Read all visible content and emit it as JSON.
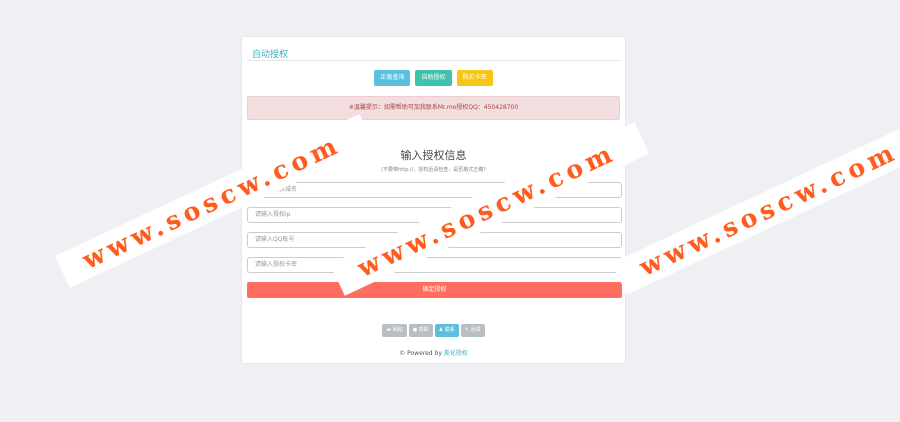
{
  "panel": {
    "title": "自动授权",
    "buttons": [
      {
        "label": "正版查询",
        "color": "#5bc0de"
      },
      {
        "label": "自助授权",
        "color": "#3fc3ad"
      },
      {
        "label": "购买卡密",
        "color": "#f5c518"
      }
    ],
    "alert": "※温馨提示：如需帮助可加我联系Mr.mo授权QQ：450428700"
  },
  "form": {
    "heading": "输入授权信息",
    "subheading": "(不要带http://，授权后请检查，是否格式正确?",
    "fields": [
      {
        "placeholder": "请输入授权域名"
      },
      {
        "placeholder": "请输入授权ip"
      },
      {
        "placeholder": "请输入QQ账号"
      },
      {
        "placeholder": "请输入授权卡密"
      }
    ],
    "submit_label": "确定授权"
  },
  "footer": {
    "nav": [
      {
        "label": "网站",
        "icon": "window-icon",
        "active": false
      },
      {
        "label": "帮助",
        "icon": "help-circle-icon",
        "active": false
      },
      {
        "label": "联系",
        "icon": "user-icon",
        "active": true
      },
      {
        "label": "反馈",
        "icon": "pencil-icon",
        "active": false
      }
    ],
    "powered_prefix": "© Powered by ",
    "powered_link": "美化授权"
  },
  "watermarks": [
    "www.soscw.com",
    "www.soscw.com",
    "www.soscw.com"
  ]
}
